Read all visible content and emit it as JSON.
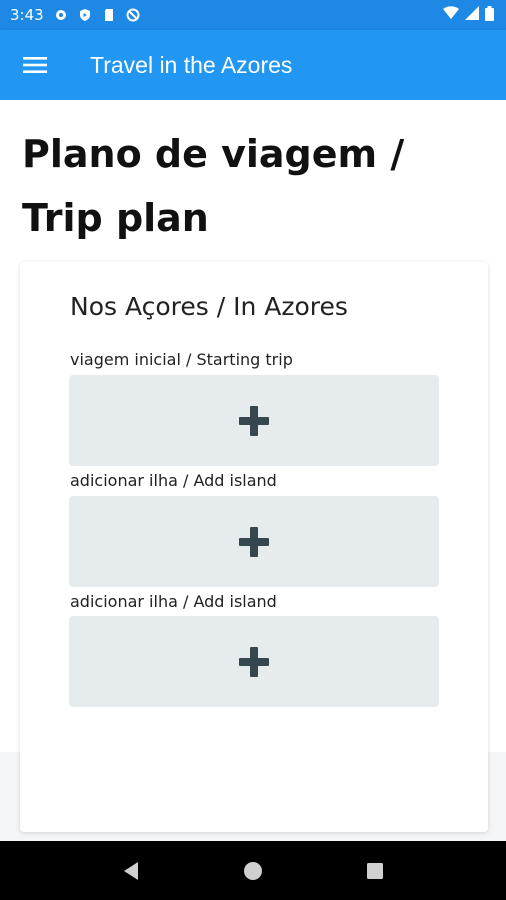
{
  "status_bar": {
    "time": "3:43",
    "left_icons": [
      "settings-icon",
      "shield-icon",
      "sd-card-icon",
      "no-sync-icon"
    ],
    "right_icons": [
      "wifi-icon",
      "signal-icon",
      "battery-icon"
    ]
  },
  "app_bar": {
    "title": "Travel in the Azores",
    "menu_icon": "hamburger-menu-icon"
  },
  "page": {
    "title": "Plano de viagem / Trip plan"
  },
  "card": {
    "title": "Nos Açores / In Azores",
    "sections": [
      {
        "label": "viagem inicial / Starting trip",
        "action_icon": "plus-icon"
      },
      {
        "label": "adicionar ilha / Add island",
        "action_icon": "plus-icon"
      },
      {
        "label": "adicionar ilha / Add island",
        "action_icon": "plus-icon"
      }
    ]
  },
  "nav_bar": {
    "buttons": [
      "back-icon",
      "home-icon",
      "recents-icon"
    ]
  },
  "colors": {
    "status_bar": "#1e88e5",
    "app_bar": "#2196f3",
    "add_box": "#e6ebee",
    "plus": "#37474f"
  }
}
